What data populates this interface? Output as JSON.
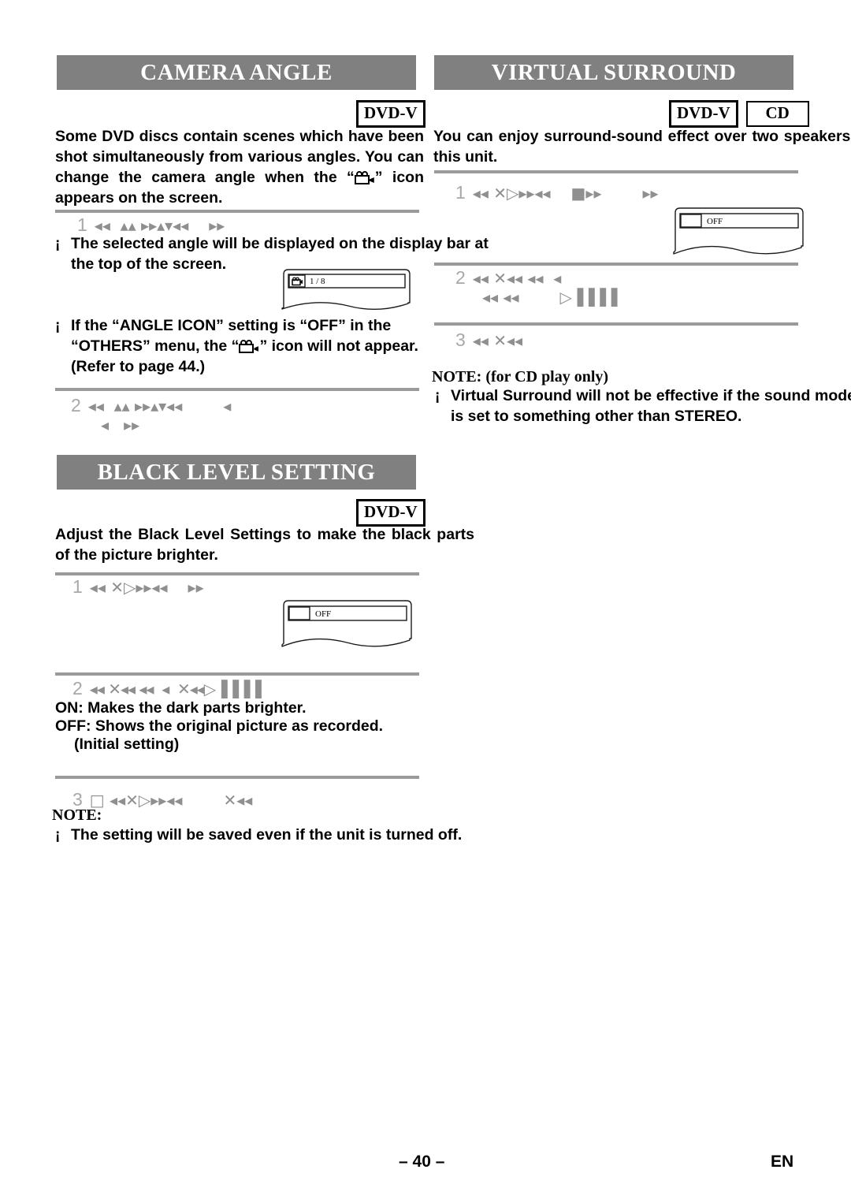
{
  "sections": {
    "camera_angle": {
      "title": "CAMERA ANGLE",
      "badges": [
        "DVD-V"
      ],
      "intro": "Some DVD discs contain scenes which have been shot simultaneously from various angles. You can change the camera angle when the “    ” icon appears on the screen.",
      "intro_part1": "Some DVD discs contain scenes which have been shot simultaneously from various angles. You can change the camera angle when the “",
      "intro_part2": "” icon appears on the screen.",
      "step1": {
        "num": "1",
        "glyphs": "◂◂  ▴▴ ▸▸▴▾◂◂",
        "glyphs_tail": "▸▸"
      },
      "bullet1": "The selected angle will be displayed on the display bar at the top of the screen.",
      "angle_display": {
        "value": "1 / 8",
        "icon": "camera-icon"
      },
      "bullet2_part1": "If the “ANGLE ICON” setting is “OFF” in the “OTHERS” menu, the “",
      "bullet2_part2": "” icon will not appear. (Refer to page 44.)",
      "step2": {
        "num": "2",
        "glyphs": "◂◂  ▴▴ ▸▸▴▾◂◂",
        "glyphs_tail": "◂",
        "glyphs_row2": "◂   ▸▸"
      }
    },
    "black_level": {
      "title": "BLACK LEVEL SETTING",
      "badges": [
        "DVD-V"
      ],
      "intro": "Adjust the Black Level Settings to make the black parts of the picture brighter.",
      "step1": {
        "num": "1",
        "glyphs": "◂◂ ✕▷▸▸◂◂",
        "glyphs_tail": "▸▸"
      },
      "screen": {
        "value": "OFF"
      },
      "step2": {
        "num": "2",
        "glyphs": "◂◂ ✕◂◂ ◂◂  ◂  ✕◂◂▷▐▐▐▐"
      },
      "desc_on": "ON:  Makes the dark parts brighter.",
      "desc_off": "OFF: Shows the original picture as recorded.",
      "desc_off_2": "(Initial setting)",
      "step3": {
        "num": "3",
        "glyphs": "□ ◂◂✕▷▸▸◂◂",
        "glyphs_tail": "✕◂◂"
      },
      "note_head": "NOTE:",
      "note_bullet": "The setting will be saved even if the unit is turned off."
    },
    "virtual_surround": {
      "title": "VIRTUAL SURROUND",
      "badges": [
        "DVD-V",
        "CD"
      ],
      "intro": "You can enjoy surround-sound effect over two speakers on this unit.",
      "step1": {
        "num": "1",
        "glyphs": "◂◂ ✕▷▸▸◂◂",
        "glyphs_mid": "■▸▸",
        "glyphs_tail": "▸▸"
      },
      "screen": {
        "value": "OFF"
      },
      "step2": {
        "num": "2",
        "glyphs": "◂◂ ✕◂◂ ◂◂  ◂",
        "glyphs_row2": "◂◂ ◂◂",
        "glyphs_row2_tail": "▷▐▐▐▐"
      },
      "step3": {
        "num": "3",
        "glyphs": "◂◂ ✕◂◂"
      },
      "note_head": "NOTE: (for CD play only)",
      "note_bullet": "Virtual Surround will not be effective if the sound mode is set to something other than STEREO."
    }
  },
  "bullet_mark": "¡",
  "footer": {
    "page_number": "– 40 –",
    "language": "EN"
  },
  "colors": {
    "header_bar": "#808080",
    "rule": "#9a9a9a",
    "text": "#000000",
    "glyph": "#8f8f8f"
  }
}
